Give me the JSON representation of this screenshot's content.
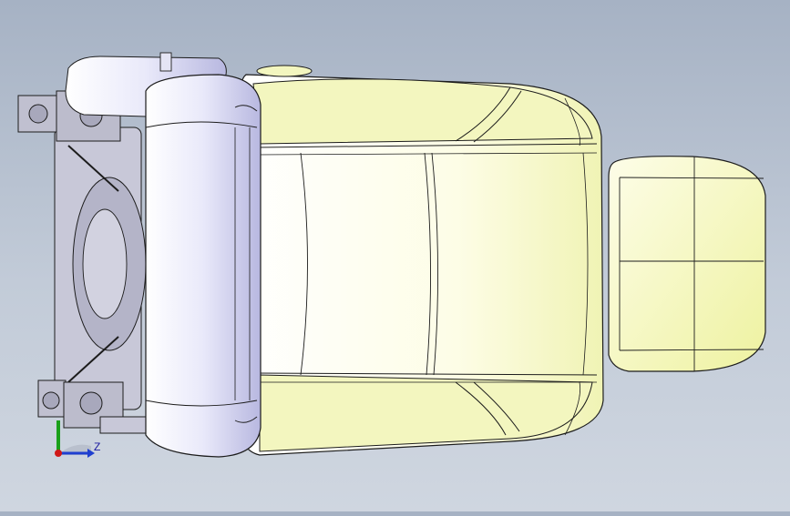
{
  "scene": {
    "background_top": "#a6b2c4",
    "background_bottom": "#cfd6e0",
    "cushion_color": "#f7f8c8",
    "cushion_edge": "#e9ed9a",
    "headrest_color": "#dcdcf4",
    "outline_color": "#1c1c1c"
  },
  "triad": {
    "z_label": "Z",
    "z_axis_color": "#1f3fd0",
    "y_axis_color": "#1aa01a",
    "origin_color": "#d01818"
  }
}
